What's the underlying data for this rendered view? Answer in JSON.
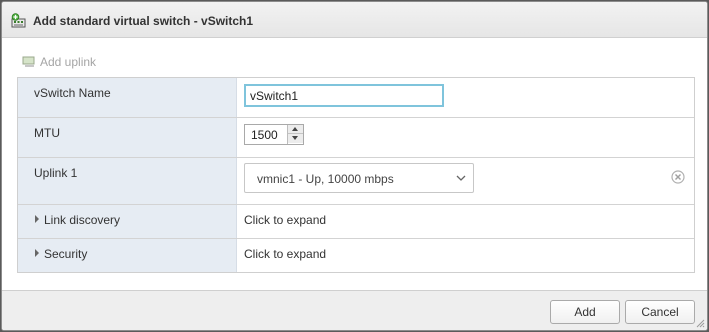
{
  "dialog": {
    "title": "Add standard virtual switch - vSwitch1",
    "title_icon": "virtual-switch-add-icon"
  },
  "toolbar": {
    "add_uplink_label": "Add uplink",
    "add_uplink_icon": "nic-add-icon",
    "add_uplink_enabled": false
  },
  "form": {
    "vswitch_name": {
      "label": "vSwitch Name",
      "value": "vSwitch1"
    },
    "mtu": {
      "label": "MTU",
      "value": "1500"
    },
    "uplink1": {
      "label": "Uplink 1",
      "value": "vmnic1 - Up, 10000 mbps",
      "clear_icon": "clear-circle-icon"
    },
    "link_discovery": {
      "label": "Link discovery",
      "value": "Click to expand"
    },
    "security": {
      "label": "Security",
      "value": "Click to expand"
    }
  },
  "footer": {
    "add_label": "Add",
    "cancel_label": "Cancel"
  },
  "colors": {
    "label_column_bg": "#e6ecf3",
    "input_focus_border": "#7fc4dc",
    "footer_bg": "#eeeeee"
  }
}
